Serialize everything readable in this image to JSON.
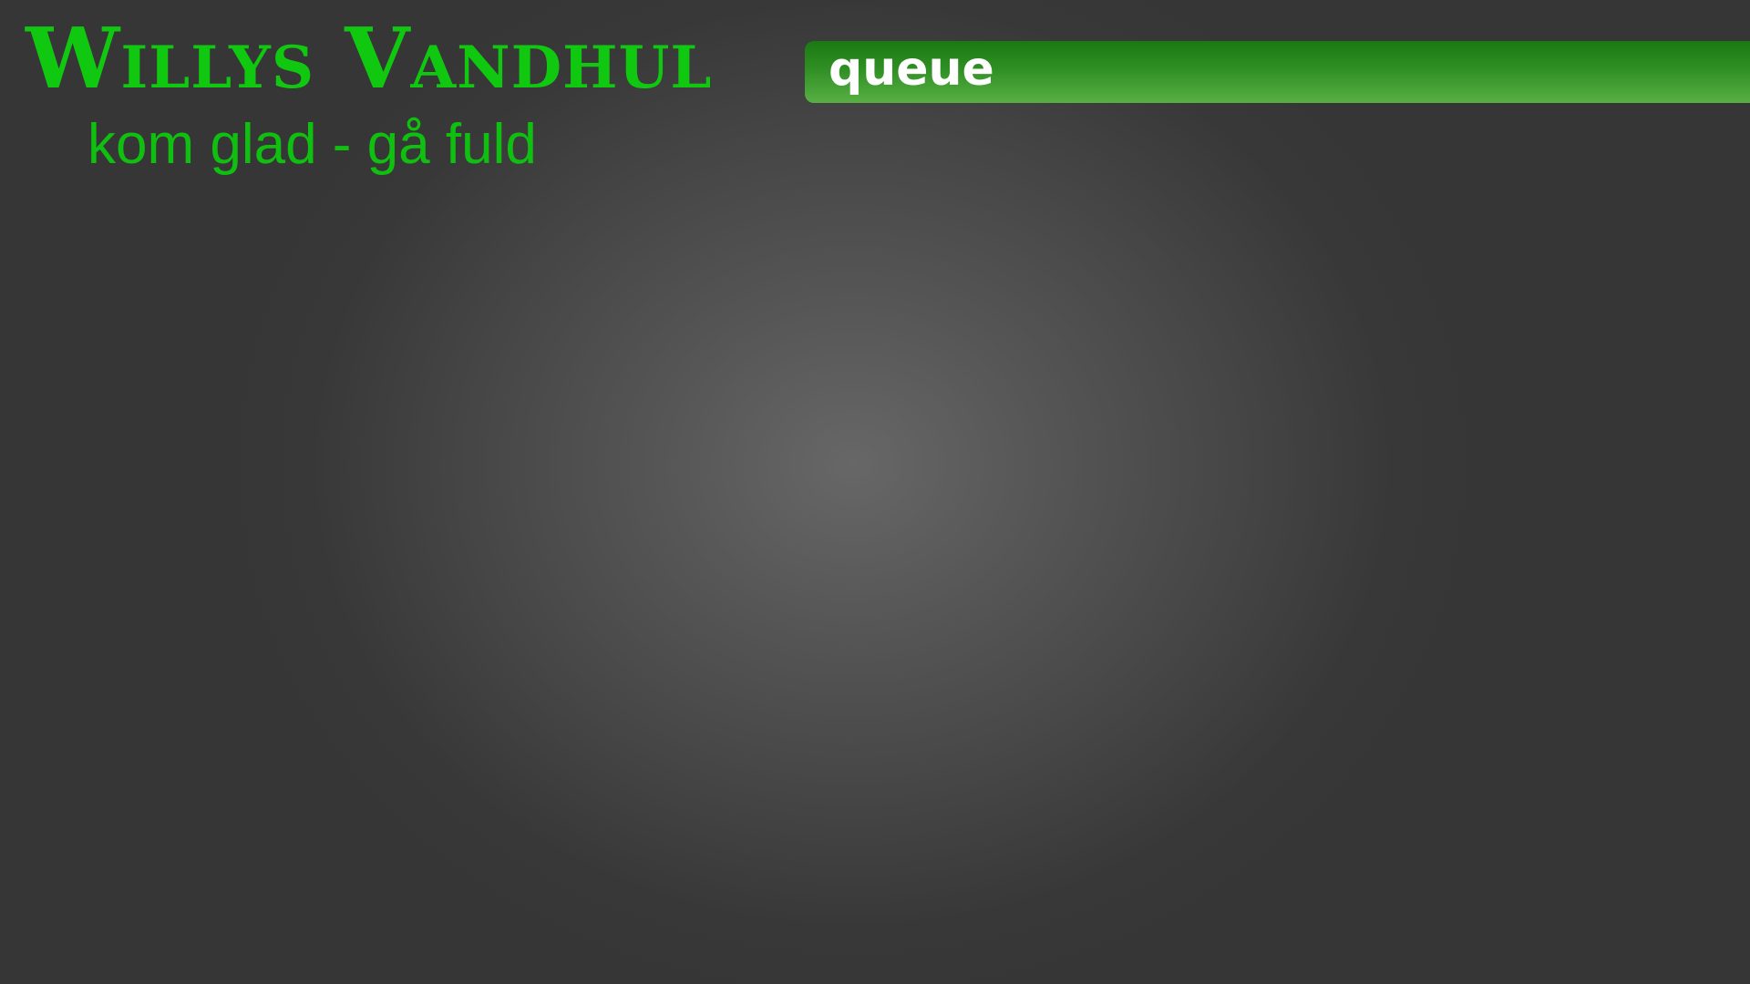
{
  "brand": {
    "title": "Willys Vandhul",
    "tagline": "kom glad - gå fuld"
  },
  "queue": {
    "label": "queue",
    "items": []
  },
  "colors": {
    "brand_green": "#10c810",
    "queue_bar_top": "#1a7a12",
    "queue_bar_bottom": "#58b044",
    "background": "#363636"
  }
}
